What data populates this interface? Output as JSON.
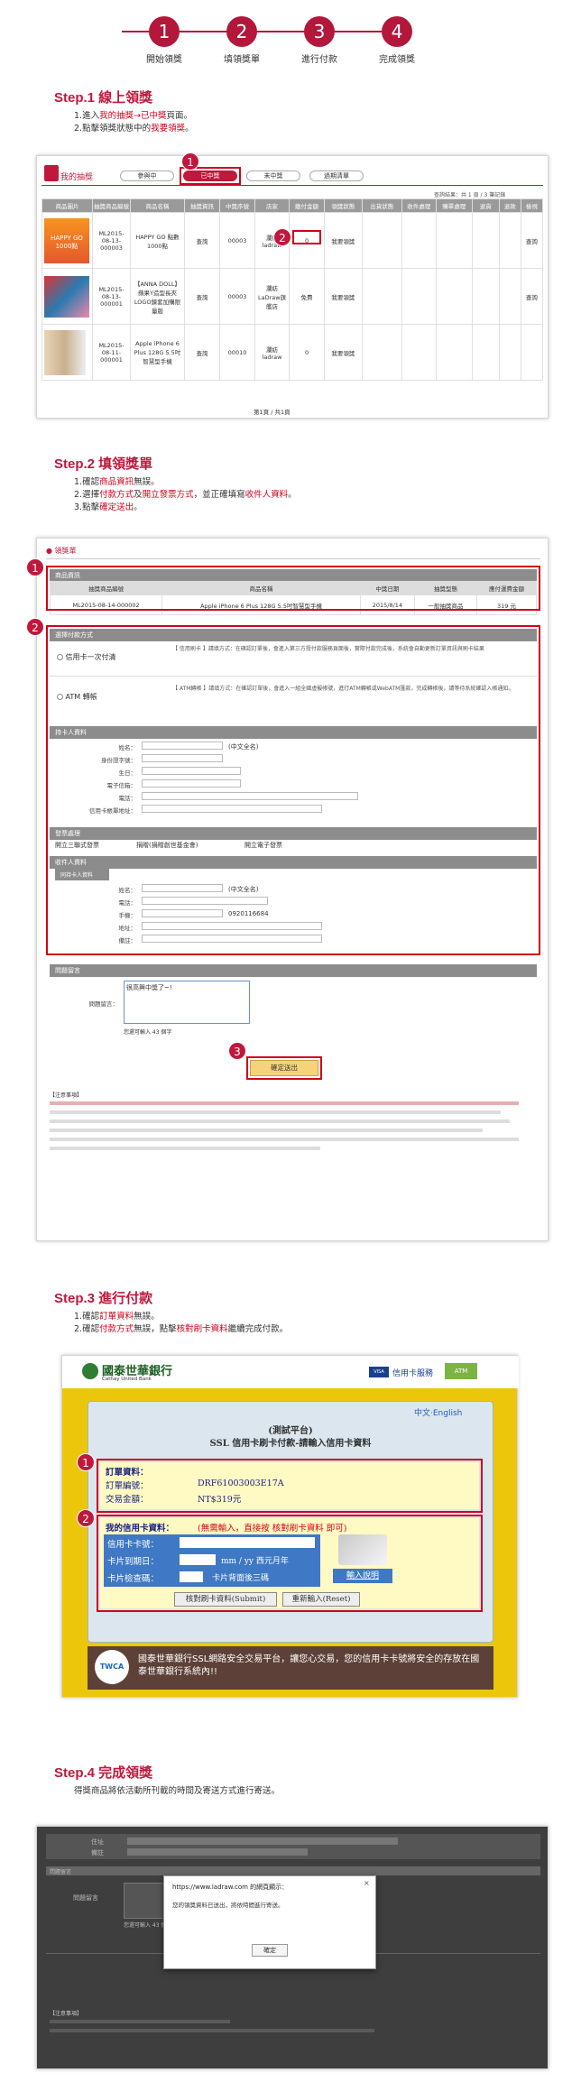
{
  "stepper": {
    "steps": [
      {
        "num": "1",
        "label": "開始領獎"
      },
      {
        "num": "2",
        "label": "填領獎單"
      },
      {
        "num": "3",
        "label": "進行付款"
      },
      {
        "num": "4",
        "label": "完成領獎"
      }
    ]
  },
  "step1": {
    "title": "Step.1 線上領獎",
    "line1_a": "1.進入",
    "line1_b": "我的抽獎→已中獎",
    "line1_c": "頁面。",
    "line2_a": "2.點擊領獎狀態中的",
    "line2_b": "我要領獎",
    "line2_c": "。",
    "screen": {
      "header": "我的抽獎",
      "tabs": [
        "參與中",
        "已中獎",
        "未中獎",
        "過期清單"
      ],
      "paging": "查詢結果：共 1 頁 / 3 筆記錄",
      "columns": [
        "商品圖片",
        "抽獎商品編號",
        "商品名稱",
        "抽獎資訊",
        "中獎序號",
        "店家",
        "繳付金額",
        "領獎狀態",
        "出貨狀態",
        "收件處理",
        "購單處理",
        "退貨",
        "退款",
        "檢視"
      ],
      "rows": [
        {
          "img": "HAPPY GO 1000點",
          "no": "ML2015-08-13-000003",
          "name": "HAPPY GO 點數1000點",
          "info": "查詢",
          "seq": "00003",
          "shop": "瀾紡ladraw",
          "fee": "0",
          "status": "我要領獎",
          "view": "查詢"
        },
        {
          "img": "ANNA DOLL",
          "no": "ML2015-08-13-000001",
          "name": "【ANNA DOLL】蘋果Y造型長夾LOGO鍊套加購限量版",
          "info": "查詢",
          "seq": "00003",
          "shop": "瀾紡LaDraw旗艦店",
          "fee": "免費",
          "status": "我要領獎",
          "view": "查詢"
        },
        {
          "img": "iPhone",
          "no": "ML2015-08-11-000001",
          "name": "Apple iPhone 6 Plus 128G 5.5吋智慧型手機",
          "info": "查詢",
          "seq": "00010",
          "shop": "瀾紡ladraw",
          "fee": "0",
          "status": "我要領獎",
          "view": ""
        }
      ],
      "pager": "第1頁 / 共1頁"
    }
  },
  "step2": {
    "title": "Step.2 填領獎單",
    "line1_a": "1.確認",
    "line1_b": "商品資訊",
    "line1_c": "無誤。",
    "line2_a": "2.選擇",
    "line2_b": "付款方式",
    "line2_c": "及",
    "line2_d": "開立發票方式",
    "line2_e": "，並正確填寫",
    "line2_f": "收件人資料",
    "line2_g": "。",
    "line3_a": "3.點擊",
    "line3_b": "確定送出",
    "line3_c": "。",
    "screen": {
      "header": "領獎單",
      "product_bar": "商品資訊",
      "pcols": [
        "抽獎商品編號",
        "商品名稱",
        "中獎日期",
        "抽獎型態",
        "應付運費金額"
      ],
      "prow": {
        "no": "ML2015-08-14-000002",
        "name": "Apple iPhone 6 Plus 128G 5.5吋智慧型手機",
        "date": "2015/8/14",
        "type": "一般抽獎商品",
        "fee": "319 元"
      },
      "pay_bar": "選擇付款方式",
      "pay1": "信用卡一次付清",
      "pay1_desc": "【 信用刷卡 】請填方式：在確認訂單後，會進入第三方授付款服務頁面後，實際付款完成後，系統會自動更新訂單資訊與刷卡結果",
      "pay2": "ATM 轉帳",
      "pay2_desc": "【 ATM轉帳 】請填方式：在確認訂單後，會進入一組全國虛擬帳號，進行ATM轉帳或WebATM匯款，完成轉帳後，請等待系統確認入帳通知。",
      "buyer_bar": "持卡人資料",
      "buyer_fields": [
        "姓名：",
        "身份證字號：",
        "生日：",
        "電子信箱：",
        "電話：",
        "信用卡帳單地址："
      ],
      "buyer_note": "(中文全名)",
      "invoice_bar": "發票處理",
      "invoice_opts": [
        "開立三聯式發票",
        "捐贈(捐贈創世基金會)",
        "開立電子發票"
      ],
      "recv_bar": "收件人資料",
      "recv_same": "同持卡人資料",
      "recv_fields": [
        "姓名：",
        "電話：",
        "手機：",
        "地址：",
        "備註："
      ],
      "recv_note": "(中文全名)",
      "recv_phone": "0920116684",
      "msg_bar": "問題留言",
      "msg_label": "問題留言：",
      "msg_value": "很高興中獎了~!",
      "msg_count": "您還可輸入 43 個字",
      "submit": "確定送出",
      "notes_title": "【注意事項】"
    }
  },
  "step3": {
    "title": "Step.3 進行付款",
    "line1_a": "1.確認",
    "line1_b": "訂單資料",
    "line1_c": "無誤。",
    "line2_a": "2.確認",
    "line2_b": "付款方式",
    "line2_c": "無誤，點擊",
    "line2_d": "核對刷卡資料",
    "line2_e": "繼續完成付款。",
    "screen": {
      "bank": "國泰世華銀行",
      "bank_en": "Cathay United Bank",
      "service": "信用卡服務",
      "links": "中文‧English",
      "test": "(測試平台)",
      "heading": "SSL 信用卡刷卡付款-請輸入信用卡資料",
      "order_title": "訂單資料：",
      "order_no_label": "訂單編號：",
      "order_no": "DRF61003003E17A",
      "amount_label": "交易金額：",
      "amount": "NT$319元",
      "card_title": "我的信用卡資料：",
      "card_hint": "(無需輸入，直接按 核對刷卡資料 即可)",
      "card_no_label": "信用卡卡號：",
      "expiry_label": "卡片到期日：",
      "expiry_hint": "mm / yy 西元月年",
      "cvv_label": "卡片檢查碼：",
      "cvv_hint": "卡片背面後三碼",
      "help": "輸入說明",
      "btn_submit": "核對刷卡資料(Submit)",
      "btn_reset": "重新輸入(Reset)",
      "footer": "國泰世華銀行SSL網路安全交易平台，讓您心交易，您的信用卡卡號將安全的存放在國泰世華銀行系統內!!",
      "twca": "TWCA"
    }
  },
  "step4": {
    "title": "Step.4 完成領獎",
    "line1": "得獎商品將依活動所刊載的時間及寄送方式進行寄送。",
    "screen": {
      "dialog_title": "https://www.ladraw.com 的網頁顯示：",
      "dialog_msg": "您的領獎資料已送出，將依時間進行寄送。",
      "dialog_ok": "確定",
      "row_labels": [
        "住址",
        "備註",
        "問題留言",
        "問題留言"
      ],
      "count": "您還可輸入 43 個字",
      "notes_title": "【注意事項】"
    }
  }
}
